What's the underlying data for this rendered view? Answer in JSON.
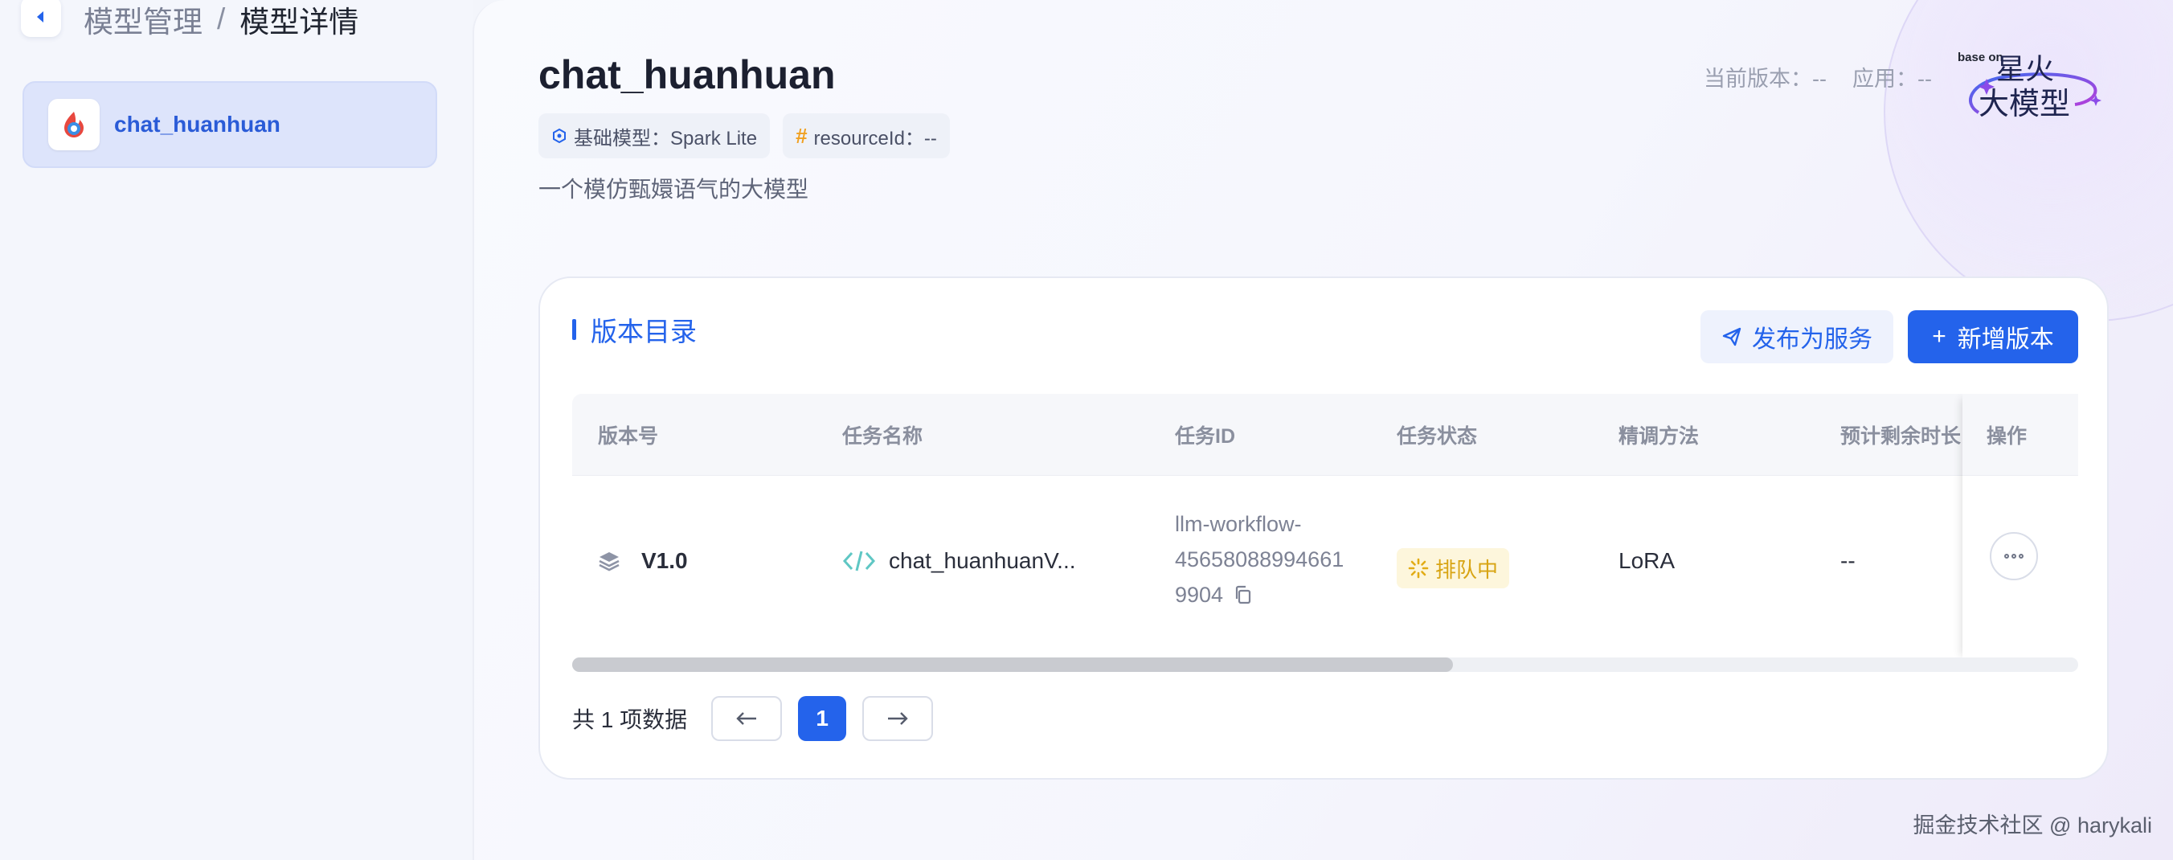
{
  "breadcrumb": {
    "parent": "模型管理",
    "separator": "/",
    "current": "模型详情"
  },
  "sidebar": {
    "items": [
      {
        "label": "chat_huanhuan",
        "icon": "model-logo-icon",
        "active": true
      }
    ]
  },
  "header": {
    "title": "chat_huanhuan",
    "tags": [
      {
        "icon": "base-model-icon",
        "text": "基础模型：Spark Lite"
      },
      {
        "icon": "hash-icon",
        "text": "resourceId：--"
      }
    ],
    "description": "一个模仿甄嬛语气的大模型",
    "current_version": "当前版本：--",
    "application": "应用：--",
    "brand": {
      "small_text": "base on",
      "line1": "星火",
      "line2": "大模型"
    }
  },
  "versions": {
    "section_title": "版本目录",
    "publish_label": "发布为服务",
    "add_label": "新增版本",
    "columns": [
      "版本号",
      "任务名称",
      "任务ID",
      "任务状态",
      "精调方法",
      "预计剩余时长",
      "操作"
    ],
    "rows": [
      {
        "version": "V1.0",
        "task_name": "chat_huanhuanV...",
        "task_id_lines": [
          "llm-workflow-",
          "45658088994661",
          "9904"
        ],
        "status": "排队中",
        "method": "LoRA",
        "remaining": "--"
      }
    ],
    "scroll_position": 0.58
  },
  "pagination": {
    "total": "共 1 项数据",
    "current_page": "1"
  },
  "watermark": "掘金技术社区 @ harykali",
  "colors": {
    "accent": "#2463eb",
    "status_pending": "#d8a413",
    "code_icon": "#5fc7c4"
  }
}
